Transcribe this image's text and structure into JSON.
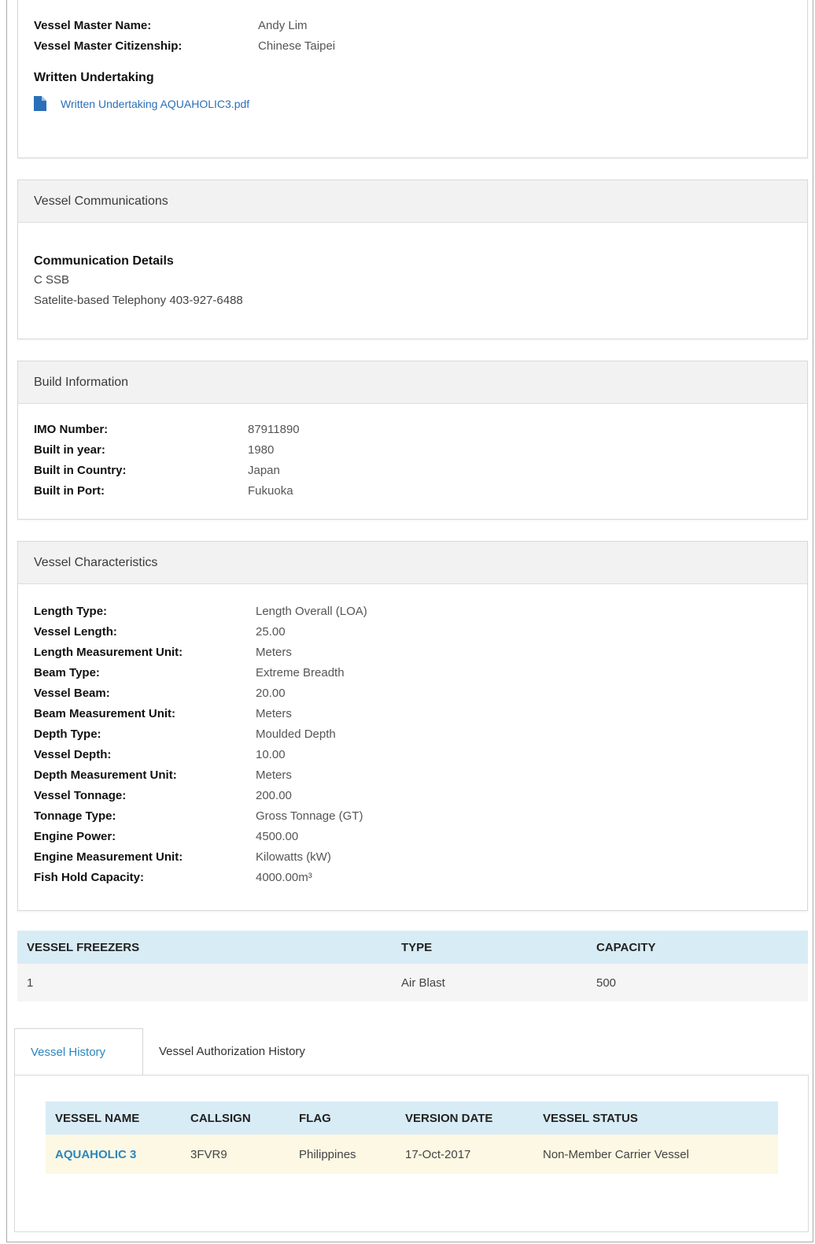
{
  "master": {
    "name_label": "Vessel Master Name:",
    "name_value": "Andy Lim",
    "citizenship_label": "Vessel Master Citizenship:",
    "citizenship_value": "Chinese Taipei",
    "undertaking_title": "Written Undertaking",
    "undertaking_file": "Written Undertaking AQUAHOLIC3.pdf",
    "file_icon": "file-icon"
  },
  "communications": {
    "header": "Vessel Communications",
    "title": "Communication Details",
    "lines": [
      "C SSB",
      "Satelite-based Telephony 403-927-6488"
    ]
  },
  "build": {
    "header": "Build Information",
    "rows": [
      {
        "label": "IMO Number:",
        "value": "87911890"
      },
      {
        "label": "Built in year:",
        "value": "1980"
      },
      {
        "label": "Built in Country:",
        "value": "Japan"
      },
      {
        "label": "Built in Port:",
        "value": "Fukuoka"
      }
    ]
  },
  "characteristics": {
    "header": "Vessel Characteristics",
    "rows": [
      {
        "label": "Length Type:",
        "value": "Length Overall (LOA)"
      },
      {
        "label": "Vessel Length:",
        "value": "25.00"
      },
      {
        "label": "Length Measurement Unit:",
        "value": "Meters"
      },
      {
        "label": "Beam Type:",
        "value": "Extreme Breadth"
      },
      {
        "label": "Vessel Beam:",
        "value": "20.00"
      },
      {
        "label": "Beam Measurement Unit:",
        "value": "Meters"
      },
      {
        "label": "Depth Type:",
        "value": "Moulded Depth"
      },
      {
        "label": "Vessel Depth:",
        "value": "10.00"
      },
      {
        "label": "Depth Measurement Unit:",
        "value": "Meters"
      },
      {
        "label": "Vessel Tonnage:",
        "value": "200.00"
      },
      {
        "label": "Tonnage Type:",
        "value": "Gross Tonnage (GT)"
      },
      {
        "label": "Engine Power:",
        "value": "4500.00"
      },
      {
        "label": "Engine Measurement Unit:",
        "value": "Kilowatts (kW)"
      },
      {
        "label": "Fish Hold Capacity:",
        "value": "4000.00m³"
      }
    ]
  },
  "freezers": {
    "headers": [
      "VESSEL FREEZERS",
      "TYPE",
      "CAPACITY"
    ],
    "rows": [
      [
        "1",
        "Air Blast",
        "500"
      ]
    ]
  },
  "tabs": [
    {
      "label": "Vessel History",
      "active": true
    },
    {
      "label": "Vessel Authorization History",
      "active": false
    }
  ],
  "history": {
    "headers": [
      "VESSEL NAME",
      "CALLSIGN",
      "FLAG",
      "VERSION DATE",
      "VESSEL STATUS"
    ],
    "rows": [
      [
        "AQUAHOLIC 3",
        "3FVR9",
        "Philippines",
        "17-Oct-2017",
        "Non-Member Carrier Vessel"
      ]
    ]
  },
  "colors": {
    "link": "#2a6fb8",
    "table_header_bg": "#d8ecf5",
    "highlight_row_bg": "#fcf8e3"
  }
}
